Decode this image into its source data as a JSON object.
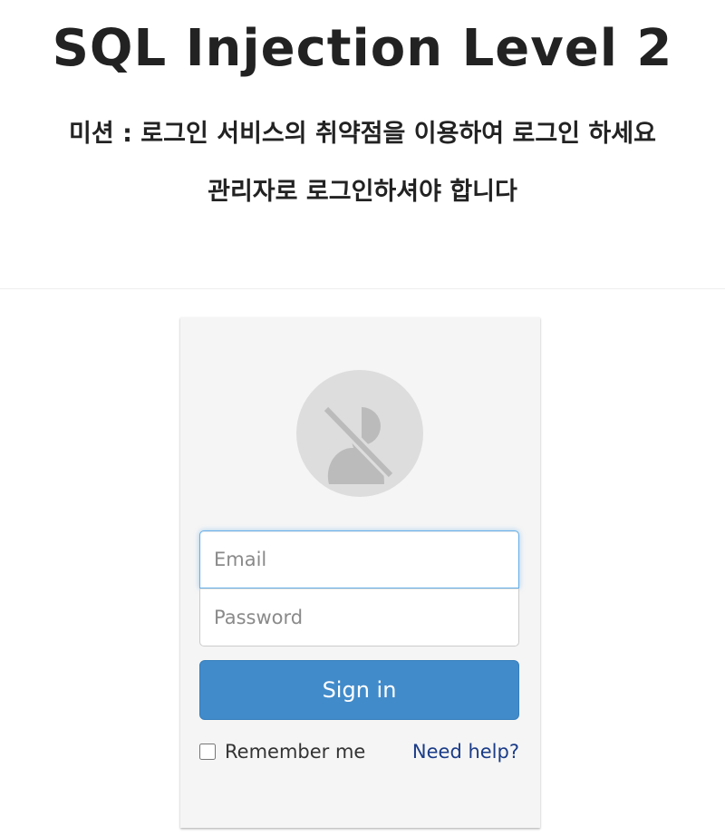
{
  "header": {
    "title": "SQL Injection Level 2",
    "mission": "미션 : 로그인 서비스의 취약점을 이용하여 로그인 하세요",
    "admin_note": "관리자로 로그인하셔야 합니다"
  },
  "login_form": {
    "avatar_icon": "no-user-icon",
    "email": {
      "placeholder": "Email",
      "value": ""
    },
    "password": {
      "placeholder": "Password",
      "value": ""
    },
    "signin_label": "Sign in",
    "remember_label": "Remember me",
    "remember_checked": false,
    "help_label": "Need help?"
  },
  "colors": {
    "primary_button": "#428bca",
    "link": "#1a3c88",
    "focus_border": "#66afe9",
    "card_background": "#f5f5f5"
  }
}
